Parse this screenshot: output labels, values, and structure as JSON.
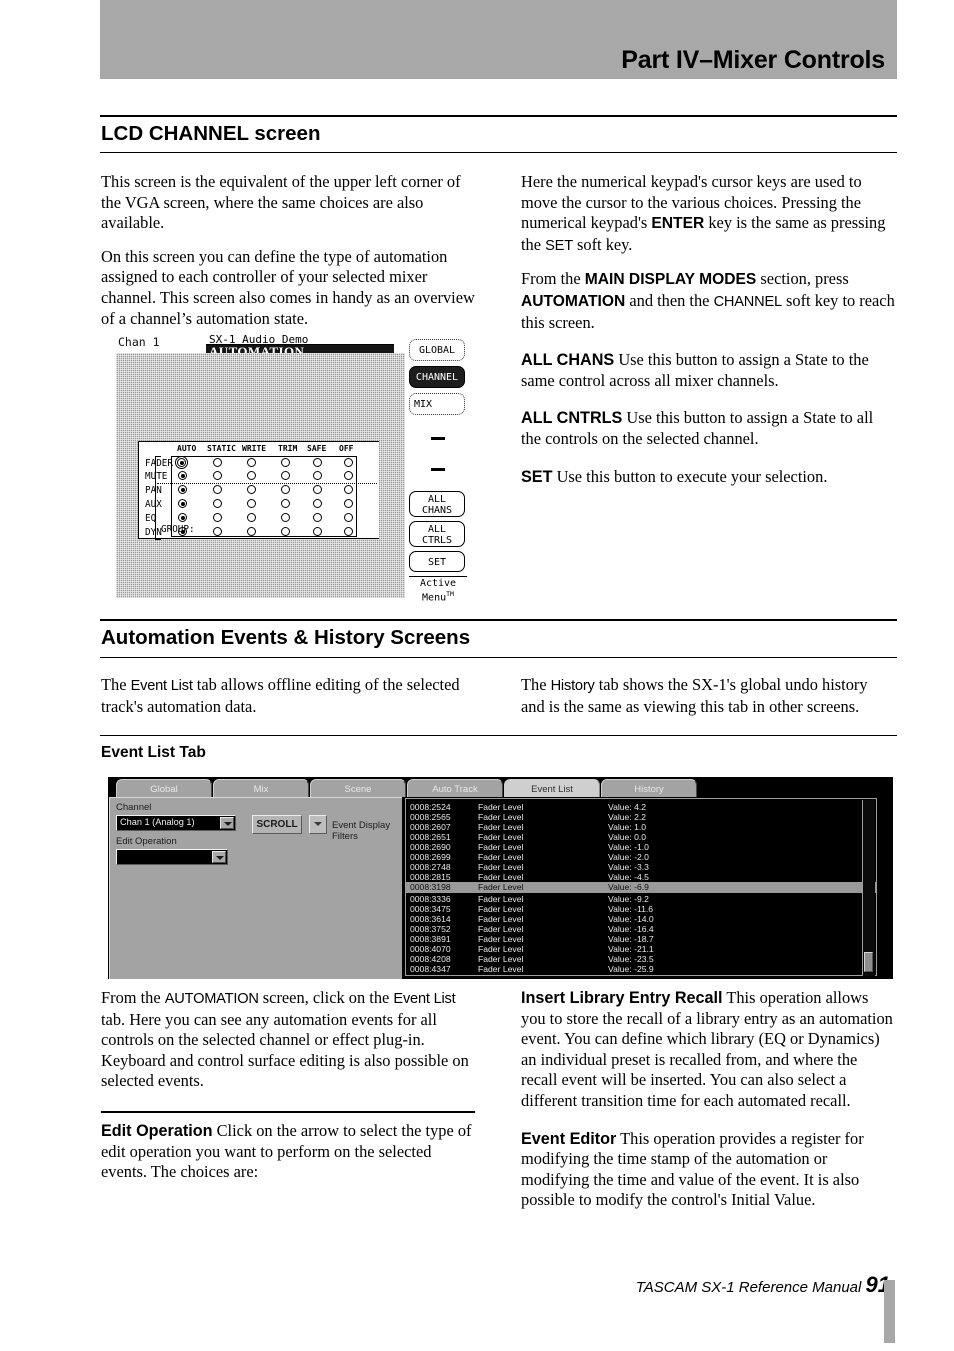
{
  "header": {
    "title": "Part IV–Mixer Controls"
  },
  "sections": {
    "lcd_channel": {
      "heading": "LCD CHANNEL screen"
    },
    "automation_events": {
      "heading": "Automation Events & History Screens"
    },
    "event_list_tab": {
      "heading": "Event List Tab"
    }
  },
  "body": {
    "lcd_left_p1": "This screen is the equivalent of the upper left corner of the VGA screen, where the same choices are also available.",
    "lcd_left_p2": "On this screen you can define the type of automation assigned to each controller of your selected mixer channel. This screen also comes in handy as an overview of a channel’s automation state.",
    "lcd_right_p1_a": "Here the numerical keypad's cursor keys are used to move the cursor to the various choices. Pressing the numerical keypad's ",
    "lcd_right_p1_b": "ENTER",
    "lcd_right_p1_c": " key is the same as pressing the ",
    "lcd_right_p1_d": "SET",
    "lcd_right_p1_e": " soft key.",
    "lcd_right_p2_a": "From the ",
    "lcd_right_p2_b": "MAIN DISPLAY MODES",
    "lcd_right_p2_c": " section, press ",
    "lcd_right_p2_d": "AUTOMATION",
    "lcd_right_p2_e": " and then the ",
    "lcd_right_p2_f": "CHANNEL",
    "lcd_right_p2_g": " soft key to reach this screen.",
    "all_chans_lead": "ALL CHANS",
    "all_chans_text": " Use this button to assign a State to the same control across all mixer channels.",
    "all_cntrls_lead": "ALL CNTRLS",
    "all_cntrls_text": " Use this button to assign a State to all the controls on the selected channel.",
    "set_lead": "SET",
    "set_text": " Use this button to execute your selection.",
    "ae_left_a": "The ",
    "ae_left_b": "Event List",
    "ae_left_c": " tab allows offline editing of the selected track's automation data.",
    "ae_right_a": "The ",
    "ae_right_b": "History",
    "ae_right_c": " tab shows the SX-1's global undo history and is the same as viewing this tab in other screens.",
    "elt_left_a": "From the ",
    "elt_left_b": "AUTOMATION",
    "elt_left_c": " screen, click on the ",
    "elt_left_d": "Event List",
    "elt_left_e": " tab. Here you can see any automation events for all controls on the selected channel or effect plug-in. Keyboard and control surface editing is also possible on selected events.",
    "edit_op_lead": "Edit Operation",
    "edit_op_text": " Click on the arrow to select the type of edit operation you want to perform on the selected events. The choices are:",
    "insert_lib_lead": "Insert Library Entry Recall",
    "insert_lib_text": " This operation allows you to store the recall of a library entry as an automation event. You can define which library (EQ or Dynamics) an individual preset is recalled from, and where the recall event will be inserted. You can also select a different transition time for each automated recall.",
    "event_editor_lead": "Event Editor",
    "event_editor_text": " This operation provides a register for modifying the time stamp of the automation or modifying the time and value of the event. It is also possible to modify the control's Initial Value."
  },
  "lcd_figure": {
    "chan_label": "Chan 1",
    "project_name": "SX-1 Audio Demo",
    "mode_banner": "AUTOMATION",
    "columns": [
      "AUTO",
      "STATIC",
      "WRITE",
      "TRIM",
      "SAFE",
      "OFF"
    ],
    "rows": [
      {
        "label": "FADER",
        "selected": "AUTO",
        "cursor": true
      },
      {
        "label": "MUTE",
        "selected": "AUTO",
        "cursor": false
      },
      {
        "label": "PAN",
        "selected": "AUTO",
        "cursor": false
      },
      {
        "label": "AUX",
        "selected": "AUTO",
        "cursor": false
      },
      {
        "label": "EQ",
        "selected": "AUTO",
        "cursor": false
      },
      {
        "label": "DYN",
        "selected": "AUTO",
        "cursor": false
      }
    ],
    "group_label": "GROUP:",
    "soft_keys": [
      {
        "label": "GLOBAL",
        "style": "outline"
      },
      {
        "label": "CHANNEL",
        "style": "inverted"
      },
      {
        "label": "MIX",
        "style": "outline"
      },
      {
        "label": "—",
        "style": "dash"
      },
      {
        "label": "—",
        "style": "dash"
      },
      {
        "label": "ALL\nCHANS",
        "style": "solid"
      },
      {
        "label": "ALL\nCTRLS",
        "style": "solid"
      },
      {
        "label": "SET",
        "style": "solid"
      }
    ],
    "soft_key_lines": {
      "all_chans_1": "ALL",
      "all_chans_2": "CHANS",
      "all_ctrls_1": "ALL",
      "all_ctrls_2": "CTRLS",
      "set": "SET",
      "global": "GLOBAL",
      "channel": "CHANNEL",
      "mix": "MIX"
    },
    "active_menu_1": "Active",
    "active_menu_2": "Menu",
    "active_menu_tm": "TM"
  },
  "event_figure": {
    "tabs": [
      {
        "label": "Global",
        "active": false
      },
      {
        "label": "Mix",
        "active": false
      },
      {
        "label": "Scene",
        "active": false
      },
      {
        "label": "Auto Track",
        "active": false
      },
      {
        "label": "Event List",
        "active": true
      },
      {
        "label": "History",
        "active": false
      }
    ],
    "channel_label": "Channel",
    "channel_value": "Chan 1 (Analog 1)",
    "edit_operation_label": "Edit Operation",
    "edit_operation_value": "",
    "scroll_button": "SCROLL",
    "event_display_filters": "Event Display Filters",
    "events": [
      {
        "time": "0008:2524",
        "param": "Fader Level",
        "value": "Value: 4.2",
        "selected": false
      },
      {
        "time": "0008:2565",
        "param": "Fader Level",
        "value": "Value: 2.2",
        "selected": false
      },
      {
        "time": "0008:2607",
        "param": "Fader Level",
        "value": "Value: 1.0",
        "selected": false
      },
      {
        "time": "0008:2651",
        "param": "Fader Level",
        "value": "Value: 0.0",
        "selected": false
      },
      {
        "time": "0008:2690",
        "param": "Fader Level",
        "value": "Value: -1.0",
        "selected": false
      },
      {
        "time": "0008:2699",
        "param": "Fader Level",
        "value": "Value: -2.0",
        "selected": false
      },
      {
        "time": "0008:2748",
        "param": "Fader Level",
        "value": "Value: -3.3",
        "selected": false
      },
      {
        "time": "0008:2815",
        "param": "Fader Level",
        "value": "Value: -4.5",
        "selected": false
      },
      {
        "time": "0008:3198",
        "param": "Fader Level",
        "value": "Value: -6.9",
        "selected": true
      },
      {
        "time": "0008:3336",
        "param": "Fader Level",
        "value": "Value: -9.2",
        "selected": false
      },
      {
        "time": "0008:3475",
        "param": "Fader Level",
        "value": "Value: -11.6",
        "selected": false
      },
      {
        "time": "0008:3614",
        "param": "Fader Level",
        "value": "Value: -14.0",
        "selected": false
      },
      {
        "time": "0008:3752",
        "param": "Fader Level",
        "value": "Value: -16.4",
        "selected": false
      },
      {
        "time": "0008:3891",
        "param": "Fader Level",
        "value": "Value: -18.7",
        "selected": false
      },
      {
        "time": "0008:4070",
        "param": "Fader Level",
        "value": "Value: -21.1",
        "selected": false
      },
      {
        "time": "0008:4208",
        "param": "Fader Level",
        "value": "Value: -23.5",
        "selected": false
      },
      {
        "time": "0008:4347",
        "param": "Fader Level",
        "value": "Value: -25.9",
        "selected": false
      }
    ]
  },
  "footer": {
    "text": "TASCAM SX-1 Reference Manual",
    "page": "91"
  },
  "colors": {
    "header_band": "#a8a8a8",
    "lcd_screen": "#9b9b9b",
    "ui_chrome": "#a3a3a3",
    "list_background": "#000000",
    "highlight_row": "#9a9a9a"
  }
}
